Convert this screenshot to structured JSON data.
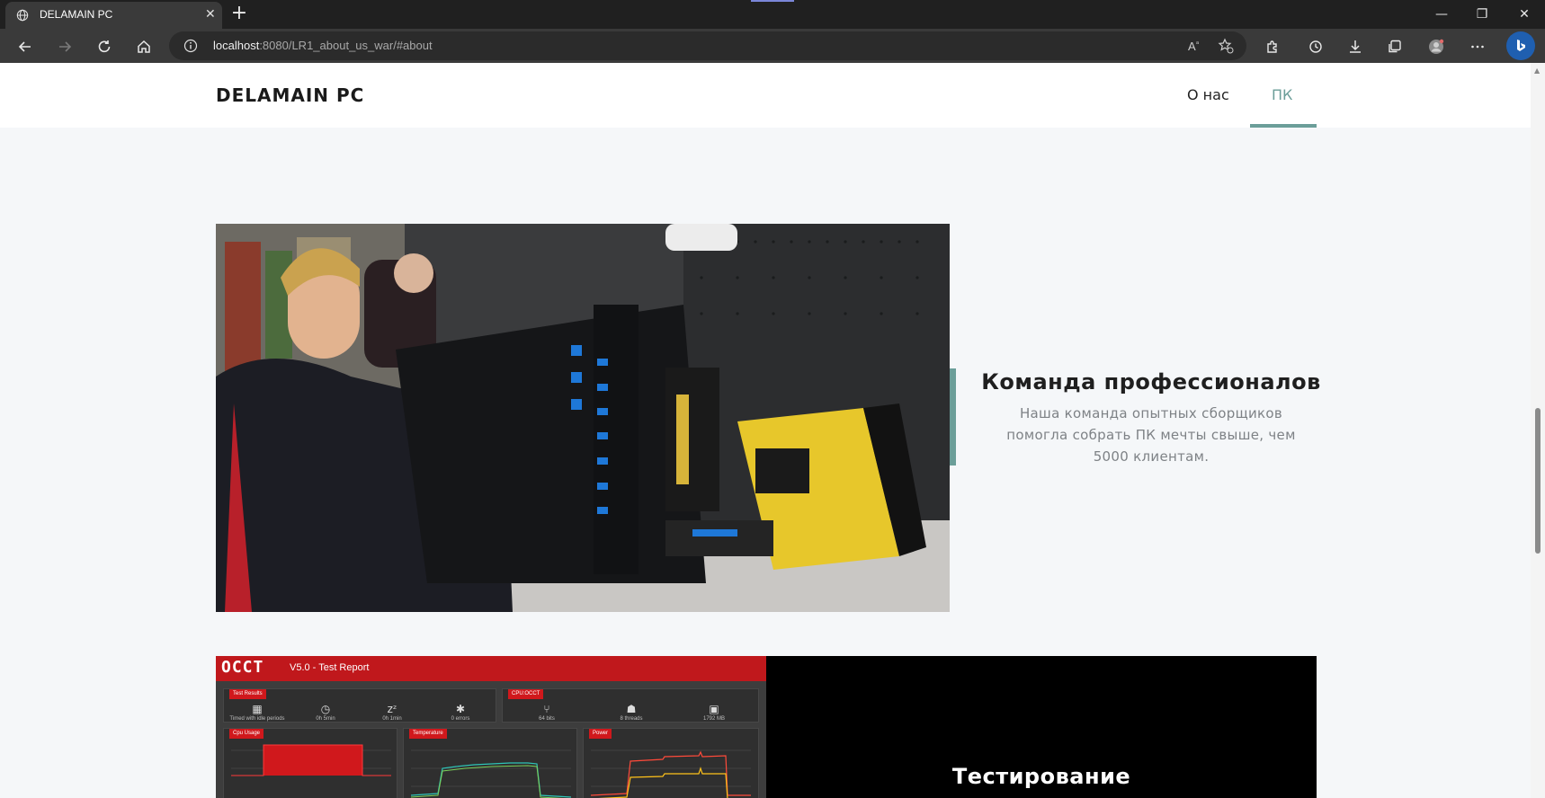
{
  "browser": {
    "tab_title": "DELAMAIN PC",
    "url_host": "localhost",
    "url_rest": ":8080/LR1_about_us_war/#about"
  },
  "site": {
    "brand": "DELAMAIN PC",
    "nav": [
      {
        "label": "О нас",
        "active": false
      },
      {
        "label": "ПК",
        "active": true
      }
    ],
    "accent_color": "#6b9e99"
  },
  "features": [
    {
      "title": "Команда профессионалов",
      "text": "Наша команда опытных сборщиков помогла собрать ПК мечты свыше, чем 5000 клиентам."
    },
    {
      "title": "Тестирование"
    }
  ],
  "report": {
    "logo": "OCCT",
    "version": "V5.0 - Test Report",
    "results_tag": "Test Results",
    "cpu_tag": "CPU:OCCT",
    "stats": [
      {
        "icon": "calendar-icon",
        "glyph": "▦",
        "caption": "Timed with idle periods"
      },
      {
        "icon": "stopwatch-icon",
        "glyph": "◷",
        "caption": "0h 5min"
      },
      {
        "icon": "sleep-icon",
        "glyph": "zᶻ",
        "caption": "0h 1min"
      },
      {
        "icon": "error-icon",
        "glyph": "✱",
        "caption": "0 errors"
      },
      {
        "icon": "bits-icon",
        "glyph": "⑂",
        "caption": "64 bits"
      },
      {
        "icon": "threads-icon",
        "glyph": "☗",
        "caption": "8 threads"
      },
      {
        "icon": "memory-icon",
        "glyph": "▣",
        "caption": "1792 MB"
      }
    ],
    "panels": [
      {
        "tag": "Cpu Usage"
      },
      {
        "tag": "Temperature"
      },
      {
        "tag": "Power"
      }
    ]
  }
}
